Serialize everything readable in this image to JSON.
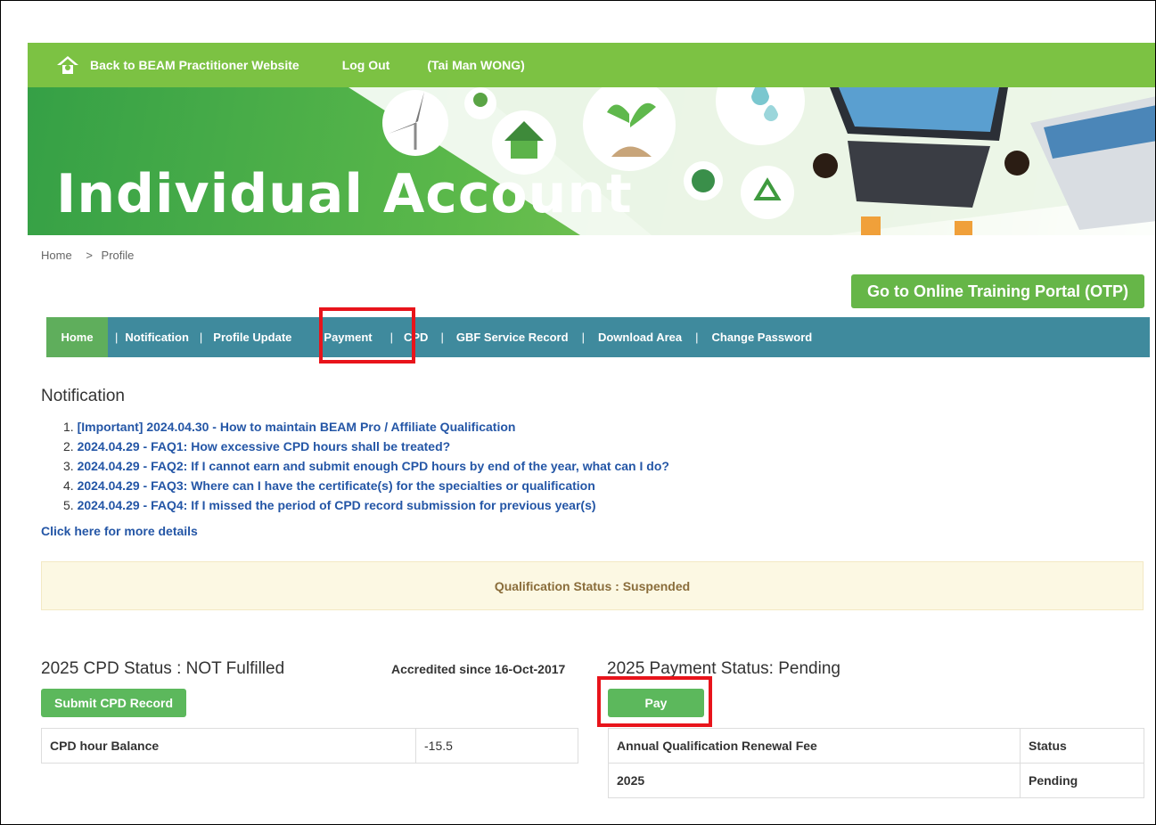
{
  "topbar": {
    "back_link": "Back to BEAM Practitioner Website",
    "logout": "Log Out",
    "user": "(Tai Man WONG)"
  },
  "banner": {
    "title": "Individual Account"
  },
  "breadcrumb": {
    "home": "Home",
    "sep": ">",
    "current": "Profile"
  },
  "otp_button": "Go to Online Training Portal (OTP)",
  "nav": {
    "home": "Home",
    "items": [
      "Notification",
      "Profile Update",
      "Payment",
      "CPD",
      "GBF Service Record",
      "Download Area",
      "Change Password"
    ],
    "separator": "|"
  },
  "notification": {
    "heading": "Notification",
    "items": [
      "[Important] 2024.04.30 - How to maintain BEAM Pro / Affiliate Qualification",
      "2024.04.29 - FAQ1: How excessive CPD hours shall be treated?",
      "2024.04.29 - FAQ2: If I cannot earn and submit enough CPD hours by end of the year, what can I do?",
      "2024.04.29 - FAQ3: Where can I have the certificate(s) for the specialties or qualification",
      "2024.04.29 - FAQ4: If I missed the period of CPD record submission for previous year(s)"
    ],
    "numbers": [
      "1.",
      "2.",
      "3.",
      "4.",
      "5."
    ],
    "more": "Click here for more details"
  },
  "qualification_status": "Qualification Status : Suspended",
  "cpd": {
    "heading": "2025 CPD Status : NOT Fulfilled",
    "accredited": "Accredited since 16-Oct-2017",
    "submit_button": "Submit CPD Record",
    "balance_label": "CPD hour Balance",
    "balance_value": "-15.5"
  },
  "payment": {
    "heading": "2025 Payment Status: Pending",
    "pay_button": "Pay",
    "col_fee": "Annual Qualification Renewal Fee",
    "col_status": "Status",
    "row_year": "2025",
    "row_status": "Pending"
  },
  "colors": {
    "topbar": "#7cc243",
    "nav": "#3f8a9d",
    "highlight": "#e8141b",
    "button_green": "#5cb85c"
  }
}
